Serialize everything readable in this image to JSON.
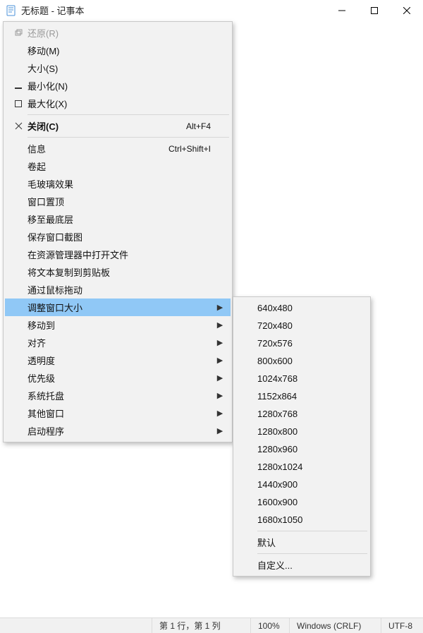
{
  "window": {
    "title": "无标题 - 记事本"
  },
  "statusbar": {
    "position": "第 1 行，第 1 列",
    "zoom": "100%",
    "line_ending": "Windows (CRLF)",
    "encoding": "UTF-8"
  },
  "system_menu": {
    "restore": {
      "label": "还原(R)"
    },
    "move": {
      "label": "移动(M)"
    },
    "size": {
      "label": "大小(S)"
    },
    "minimize": {
      "label": "最小化(N)"
    },
    "maximize": {
      "label": "最大化(X)"
    },
    "close": {
      "label": "关闭(C)",
      "shortcut": "Alt+F4"
    },
    "info": {
      "label": "信息",
      "shortcut": "Ctrl+Shift+I"
    },
    "rollup": {
      "label": "卷起"
    },
    "glass": {
      "label": "毛玻璃效果"
    },
    "ontop": {
      "label": "窗口置顶"
    },
    "tobottom": {
      "label": "移至最底层"
    },
    "savescr": {
      "label": "保存窗口截图"
    },
    "openinexp": {
      "label": "在资源管理器中打开文件"
    },
    "copytext": {
      "label": "将文本复制到剪贴板"
    },
    "dragmouse": {
      "label": "通过鼠标拖动"
    },
    "resize": {
      "label": "调整窗口大小"
    },
    "moveto": {
      "label": "移动到"
    },
    "align": {
      "label": "对齐"
    },
    "opacity": {
      "label": "透明度"
    },
    "priority": {
      "label": "优先级"
    },
    "tray": {
      "label": "系统托盘"
    },
    "otherwin": {
      "label": "其他窗口"
    },
    "startprog": {
      "label": "启动程序"
    }
  },
  "resize_submenu": {
    "r0": "640x480",
    "r1": "720x480",
    "r2": "720x576",
    "r3": "800x600",
    "r4": "1024x768",
    "r5": "1152x864",
    "r6": "1280x768",
    "r7": "1280x800",
    "r8": "1280x960",
    "r9": "1280x1024",
    "r10": "1440x900",
    "r11": "1600x900",
    "r12": "1680x1050",
    "default": "默认",
    "custom": "自定义..."
  }
}
